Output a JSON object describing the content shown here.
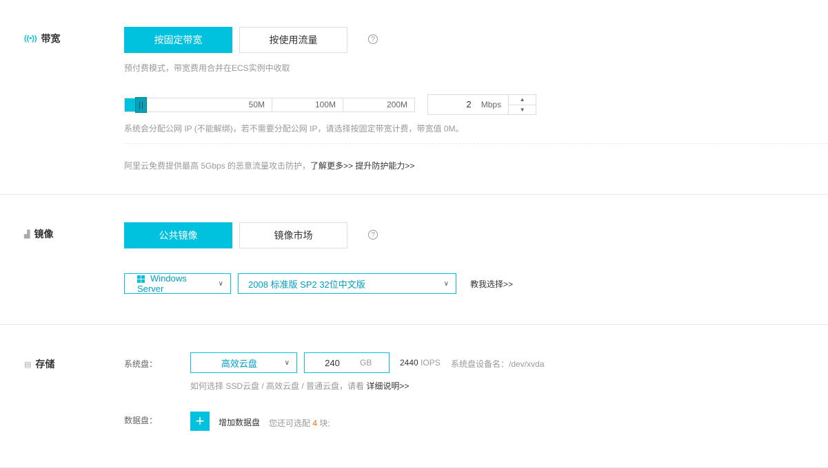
{
  "bandwidth": {
    "title": "带宽",
    "icon": "signal-icon",
    "tabs": [
      {
        "label": "按固定带宽",
        "active": true
      },
      {
        "label": "按使用流量",
        "active": false
      }
    ],
    "help": "?",
    "mode_note": "预付费模式，带宽费用合并在ECS实例中收取",
    "slider": {
      "ticks": [
        "50M",
        "100M",
        "200M"
      ],
      "value_fraction": 0.01
    },
    "value": "2",
    "unit": "Mbps",
    "ip_note": "系统会分配公网 IP (不能解绑)，若不需要分配公网 IP，请选择按固定带宽计费，带宽值 0M。",
    "ddos_note": "阿里云免费提供最高 5Gbps 的恶意流量攻击防护，",
    "learn_more": "了解更多>>",
    "upgrade": "提升防护能力>>"
  },
  "image": {
    "title": "镜像",
    "icon": "image-icon",
    "tabs": [
      {
        "label": "公共镜像",
        "active": true
      },
      {
        "label": "镜像市场",
        "active": false
      }
    ],
    "help": "?",
    "os": "Windows Server",
    "version": "2008 标准版 SP2 32位中文版",
    "help_choose": "教我选择>>"
  },
  "storage": {
    "title": "存储",
    "icon": "disk-icon",
    "system_disk_label": "系统盘：",
    "disk_type": "高效云盘",
    "size": "240",
    "size_unit": "GB",
    "iops_value": "2440",
    "iops_unit": "IOPS",
    "device_name": "系统盘设备名：/dev/xvda",
    "disk_note": "如何选择 SSD云盘 / 高效云盘 / 普通云盘，请看",
    "detail_link": "详细说明>>",
    "data_disk_label": "数据盘：",
    "add_icon": "+",
    "add_disk": "增加数据盘",
    "remaining_prefix": "您还可选配",
    "remaining_count": "4",
    "remaining_suffix": "块;"
  },
  "colors": {
    "accent": "#00c1de",
    "warn": "#ff6600"
  }
}
